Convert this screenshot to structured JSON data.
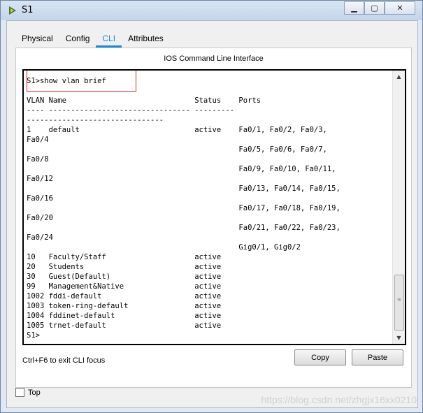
{
  "window": {
    "title": "S1",
    "minimize": "▁",
    "maximize": "▢",
    "close": "✕"
  },
  "tabs": [
    {
      "label": "Physical"
    },
    {
      "label": "Config"
    },
    {
      "label": "CLI",
      "active": true
    },
    {
      "label": "Attributes"
    }
  ],
  "panel": {
    "header": "IOS Command Line Interface"
  },
  "terminal": {
    "lines": [
      "S1>show vlan brief",
      "",
      "VLAN Name                             Status    Ports",
      "---- -------------------------------- ---------",
      "-------------------------------",
      "1    default                          active    Fa0/1, Fa0/2, Fa0/3,",
      "Fa0/4",
      "                                                Fa0/5, Fa0/6, Fa0/7,",
      "Fa0/8",
      "                                                Fa0/9, Fa0/10, Fa0/11,",
      "Fa0/12",
      "                                                Fa0/13, Fa0/14, Fa0/15,",
      "Fa0/16",
      "                                                Fa0/17, Fa0/18, Fa0/19,",
      "Fa0/20",
      "                                                Fa0/21, Fa0/22, Fa0/23,",
      "Fa0/24",
      "                                                Gig0/1, Gig0/2",
      "10   Faculty/Staff                    active",
      "20   Students                         active",
      "30   Guest(Default)                   active",
      "99   Management&Native                active",
      "1002 fddi-default                     active",
      "1003 token-ring-default               active",
      "1004 fddinet-default                  active",
      "1005 trnet-default                    active",
      "S1>"
    ],
    "scroll_up": "▲",
    "scroll_down": "▼",
    "grip": "≡"
  },
  "footer": {
    "hint": "Ctrl+F6 to exit CLI focus",
    "copy_label": "Copy",
    "paste_label": "Paste",
    "top_label": "Top",
    "top_checked": false
  },
  "watermark": "https://blog.csdn.net/zhgjx16xx0210",
  "colors": {
    "active_tab": "#1e8ad6",
    "highlight_box": "#dd2222"
  }
}
